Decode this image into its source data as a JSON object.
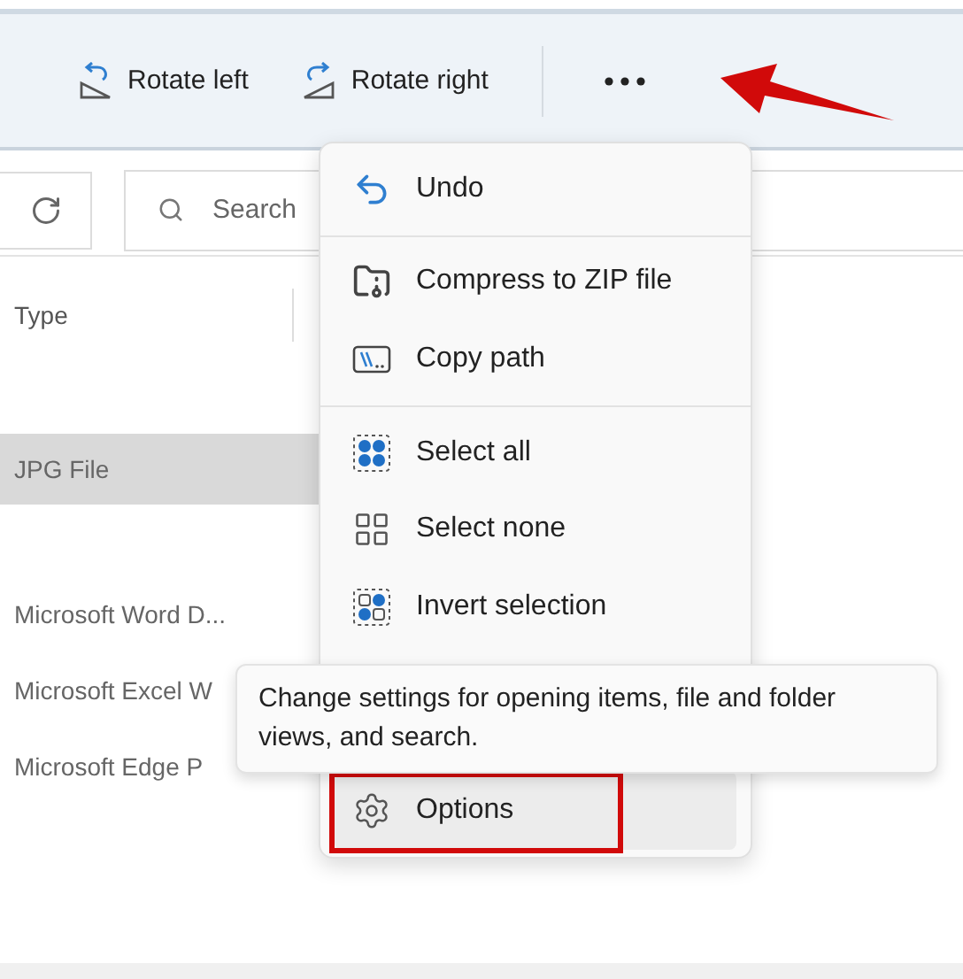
{
  "toolbar": {
    "buttons": [
      {
        "label": "Rotate left",
        "kind": "rotate-left"
      },
      {
        "label": "Rotate right",
        "kind": "rotate-right"
      }
    ]
  },
  "search": {
    "placeholder": "Search"
  },
  "file_list": {
    "columns": [
      "Type"
    ],
    "rows": [
      {
        "type": "JPG File",
        "selected": true
      },
      {
        "type": "Microsoft Word D...",
        "selected": false
      },
      {
        "type": "Microsoft Excel W",
        "selected": false
      },
      {
        "type": "Microsoft Edge P",
        "selected": false
      }
    ]
  },
  "menu": {
    "items": [
      {
        "label": "Undo",
        "kind": "undo",
        "selected": false
      },
      {
        "kind": "separator"
      },
      {
        "label": "Compress to ZIP file",
        "kind": "compress",
        "selected": false
      },
      {
        "label": "Copy path",
        "kind": "copy-path",
        "selected": false
      },
      {
        "kind": "separator"
      },
      {
        "label": "Select all",
        "kind": "select-all",
        "selected": false
      },
      {
        "label": "Select none",
        "kind": "select-none",
        "selected": false
      },
      {
        "label": "Invert selection",
        "kind": "invert",
        "selected": false
      },
      {
        "kind": "hidden"
      },
      {
        "label": "Options",
        "kind": "options",
        "selected": true
      }
    ]
  },
  "tooltip": {
    "text": "Change settings for opening items, file and folder views, and search."
  }
}
